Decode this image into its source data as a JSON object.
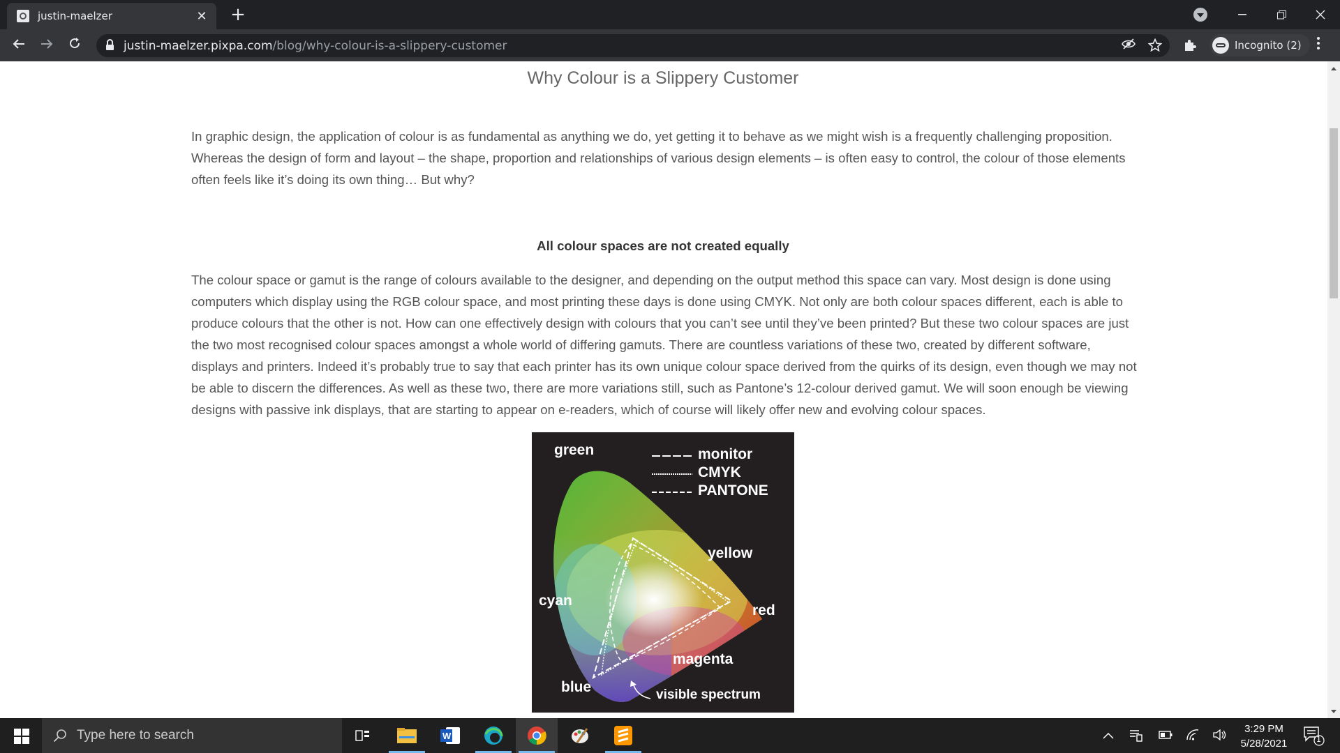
{
  "browser": {
    "tab_title": "justin-maelzer",
    "tab_close": "✕",
    "new_tab": "+",
    "url_host": "justin-maelzer.pixpa.com",
    "url_path": "/blog/why-colour-is-a-slippery-customer",
    "incognito_label": "Incognito (2)"
  },
  "article": {
    "title": "Why Colour is a Slippery Customer",
    "intro": "In graphic design, the application of colour is as fundamental as anything we do, yet getting it to behave as we might wish is a frequently challenging proposition. Whereas the design of form and layout – the shape, proportion and relationships of various design elements – is often easy to control, the colour of those elements often feels like it’s doing its own thing… But why?",
    "section_heading": "All colour spaces are not created equally",
    "body": "The colour space or gamut is the range of colours available to the designer, and depending on the output method this space can vary. Most design is done using computers which display using the RGB colour space, and most printing these days is done using CMYK. Not only are both colour spaces different, each is able to produce colours that the other is not. How can one effectively design with colours that you can’t see until they’ve been printed? But these two colour spaces are just the two most recognised colour spaces amongst a whole world of differing gamuts. There are countless variations of these two, created by different software, displays and printers. Indeed it’s probably true to say that each printer has its own unique colour space derived from the quirks of its design, even though we may not be able to discern the differences. As well as these two, there are more variations still, such as Pantone’s 12-colour derived gamut. We will soon enough be viewing designs with passive ink displays, that are starting to appear on e-readers, which of course will likely offer new and evolving colour spaces."
  },
  "figure": {
    "labels": {
      "green": "green",
      "cyan": "cyan",
      "blue": "blue",
      "yellow": "yellow",
      "red": "red",
      "magenta": "magenta",
      "visible_spectrum": "visible spectrum"
    },
    "legend": [
      "monitor",
      "CMYK",
      "PANTONE"
    ]
  },
  "taskbar": {
    "search_placeholder": "Type here to search",
    "time": "3:29 PM",
    "date": "5/28/2021",
    "notification_count": "1"
  }
}
